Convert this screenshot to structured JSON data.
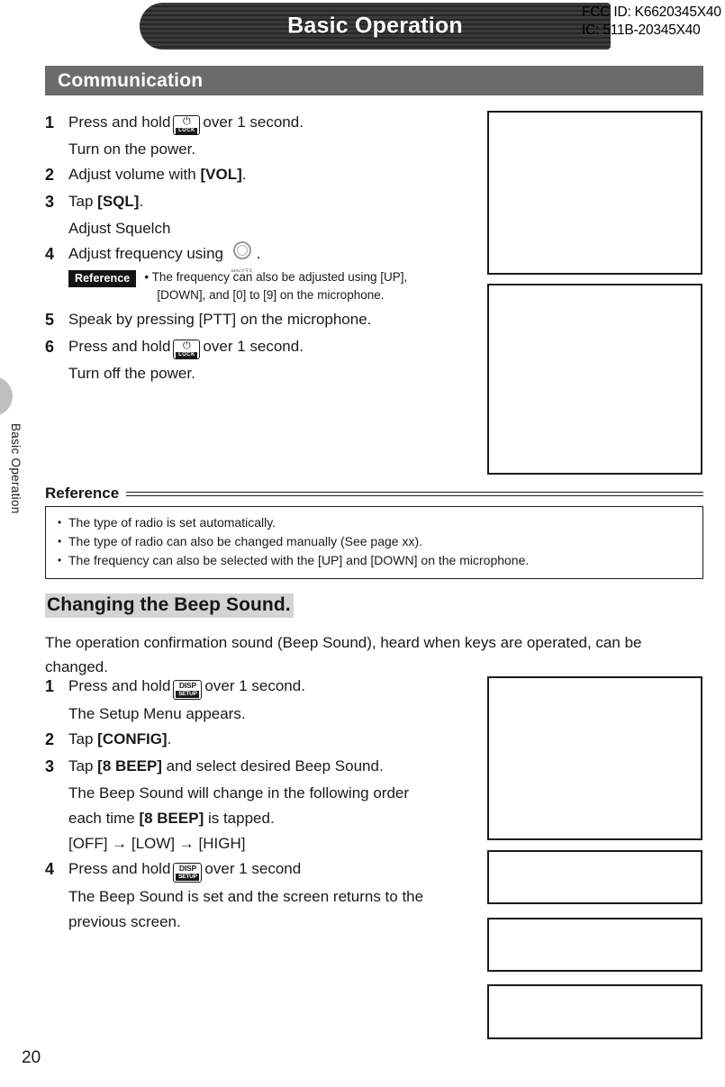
{
  "document": {
    "page_number": "20",
    "chapter_title": "Basic Operation",
    "edge_tab_label": "Basic Operation"
  },
  "regulatory": {
    "fcc_id": "FCC ID: K6620345X40",
    "ic_id": "IC: 511B-20345X40"
  },
  "section": {
    "title": "Communication"
  },
  "communication_steps": [
    {
      "num": "1",
      "text_before": "Press and hold",
      "icon": "power-lock-key-icon",
      "icon_glyph": "⏻",
      "icon_label": "LOCK",
      "text_after": "over 1 second.",
      "sub": "Turn on the power."
    },
    {
      "num": "2",
      "text_before": "Adjust volume with",
      "bold": "[VOL]",
      "text_after": "."
    },
    {
      "num": "3",
      "text_before": "Tap",
      "bold": "[SQL]",
      "text_after": ".",
      "sub": "Adjust Squelch"
    },
    {
      "num": "4",
      "text_before": "Adjust frequency using",
      "icon": "dial-knob-icon",
      "icon_label": "DIALツマミ",
      "text_after": "."
    },
    {
      "num": "5",
      "text_before": "Speak by pressing [PTT] on the microphone."
    },
    {
      "num": "6",
      "text_before": "Press and hold",
      "icon": "power-lock-key-icon",
      "icon_glyph": "⏻",
      "icon_label": "LOCK",
      "text_after": "over 1 second.",
      "sub": "Turn off the power."
    }
  ],
  "inline_reference": {
    "badge": "Reference",
    "bullet": "• The frequency can also be adjusted using [UP],",
    "bullet_continued": "[DOWN], and [0] to [9] on the microphone."
  },
  "reference_block": {
    "heading": "Reference",
    "items": [
      "The type of radio is set automatically.",
      "The type of radio can also be changed manually (See page xx).",
      "The frequency can also be selected with the [UP] and [DOWN] on the microphone."
    ]
  },
  "beep_section": {
    "heading": "Changing the Beep Sound.",
    "intro": "The operation confirmation sound (Beep Sound), heard when keys are operated, can be changed."
  },
  "beep_steps": [
    {
      "num": "1",
      "text_before": "Press and hold",
      "icon": "disp-setup-key-icon",
      "icon_top": "DISP",
      "icon_bottom": "SETUP",
      "text_after": "over 1 second.",
      "sub": "The Setup Menu appears."
    },
    {
      "num": "2",
      "text_before": "Tap",
      "bold": "[CONFIG]",
      "text_after": "."
    },
    {
      "num": "3",
      "text_before": "Tap",
      "bold": "[8 BEEP]",
      "text_after": " and select desired Beep Sound.",
      "sub_line_1": "The Beep Sound will change in the following order",
      "sub_line_2_before": "each time",
      "sub_line_2_bold": "[8 BEEP]",
      "sub_line_2_after": " is tapped.",
      "sub_line_3": "[OFF] → [LOW] → [HIGH]"
    },
    {
      "num": "4",
      "text_before": "Press and hold",
      "icon": "disp-setup-key-icon",
      "icon_top": "DISP",
      "icon_bottom": "SETUP",
      "text_after": "over 1 second",
      "sub_line_1": "The Beep Sound is set and the screen returns to the",
      "sub_line_2": "previous screen."
    }
  ],
  "colors": {
    "banner_dark": "#3a3a3a",
    "section_bar_gray": "#6b6b6b",
    "heading_highlight": "#d4d4d4",
    "edge_tab_gray": "#bfbfbf"
  }
}
